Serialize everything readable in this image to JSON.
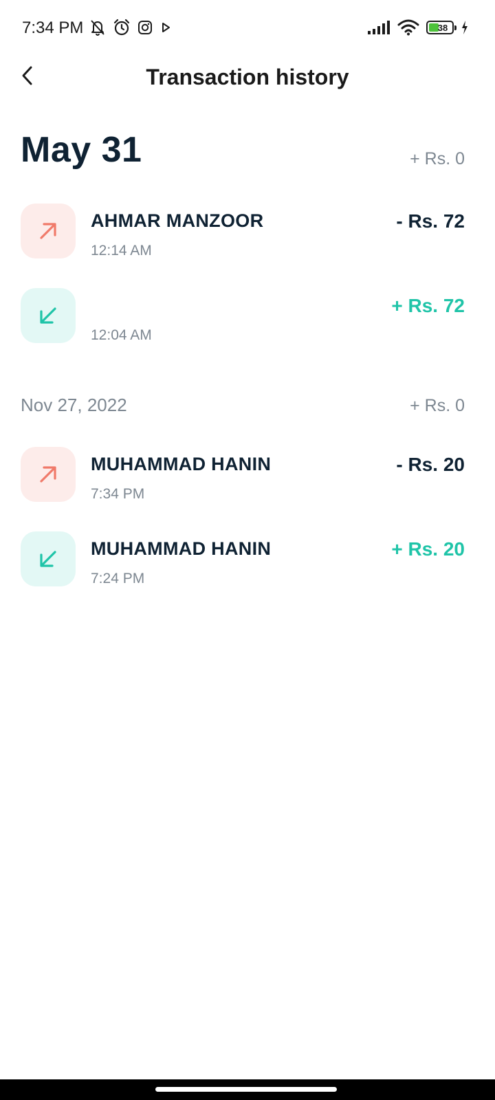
{
  "status_bar": {
    "time": "7:34 PM",
    "battery_level": "38",
    "left_icons": [
      "bell-off-icon",
      "alarm-icon",
      "instagram-icon",
      "play-icon"
    ],
    "right_icons": [
      "signal-icon",
      "wifi-icon",
      "battery-icon",
      "charging-icon"
    ]
  },
  "header": {
    "title": "Transaction history",
    "back_icon": "chevron-left-icon"
  },
  "sections": [
    {
      "date": "May 31",
      "total": "+ Rs. 0",
      "transactions": [
        {
          "direction": "out",
          "name": "AHMAR MANZOOR",
          "time": "12:14 AM",
          "amount": "- Rs. 72",
          "icon": "arrow-up-right-icon"
        },
        {
          "direction": "in",
          "name": "",
          "time": "12:04 AM",
          "amount": "+ Rs. 72",
          "icon": "arrow-down-left-icon"
        }
      ]
    },
    {
      "date": "Nov 27, 2022",
      "total": "+ Rs. 0",
      "transactions": [
        {
          "direction": "out",
          "name": "MUHAMMAD HANIN",
          "time": "7:34 PM",
          "amount": "- Rs. 20",
          "icon": "arrow-up-right-icon"
        },
        {
          "direction": "in",
          "name": "MUHAMMAD HANIN",
          "time": "7:24 PM",
          "amount": "+ Rs. 20",
          "icon": "arrow-down-left-icon"
        }
      ]
    }
  ],
  "colors": {
    "outgoing_icon_bg": "#fdecea",
    "outgoing_icon": "#f07a6a",
    "incoming_icon_bg": "#e3f8f5",
    "incoming_icon": "#1fc4a8",
    "incoming_amount": "#1fc4a8",
    "text_primary": "#0f2233",
    "text_secondary": "#7d8791"
  }
}
